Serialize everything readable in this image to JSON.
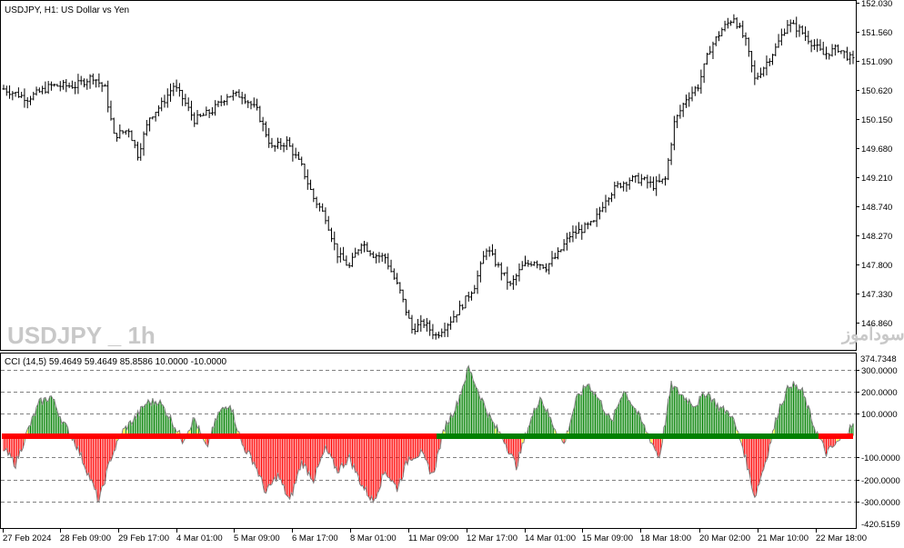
{
  "price_panel": {
    "title": "USDJPY, H1:  US Dollar vs Yen",
    "watermark_symbol": "USDJPY _ 1h",
    "watermark_site": "انتشار در سایت سودآموز",
    "y_labels": [
      "152.030",
      "151.560",
      "151.090",
      "150.620",
      "150.150",
      "149.680",
      "149.210",
      "148.740",
      "148.270",
      "147.800",
      "147.330",
      "146.860"
    ]
  },
  "indicator_panel": {
    "title": "CCI (14,5) 59.4649 59.4649 85.8586 10.0000 -10.0000",
    "y_labels": [
      "374.7348",
      "300.0000",
      "200.0000",
      "100.0000",
      "-100.0000",
      "-200.0000",
      "-300.0000",
      "-420.5159"
    ]
  },
  "x_labels": [
    "27 Feb 2024",
    "28 Feb 09:00",
    "29 Feb 17:00",
    "4 Mar 01:00",
    "5 Mar 09:00",
    "6 Mar 17:00",
    "8 Mar 01:00",
    "11 Mar 09:00",
    "12 Mar 17:00",
    "14 Mar 01:00",
    "15 Mar 09:00",
    "18 Mar 18:00",
    "20 Mar 02:00",
    "21 Mar 10:00",
    "22 Mar 18:00"
  ],
  "colors": {
    "bars": "#000000",
    "cci_up": "#008000",
    "cci_down": "#ff0000",
    "cci_neutral": "#808080",
    "cci_yellow": "#ffff00",
    "watermark": "#c8c8c8",
    "grid": "#808080"
  },
  "chart_data": [
    {
      "type": "line",
      "name": "USDJPY H1",
      "ylim": [
        146.5,
        152.03
      ],
      "anchors": [
        [
          0,
          150.65
        ],
        [
          8,
          150.5
        ],
        [
          16,
          150.7
        ],
        [
          24,
          150.7
        ],
        [
          30,
          150.85
        ],
        [
          34,
          150.65
        ],
        [
          37,
          149.9
        ],
        [
          42,
          150.0
        ],
        [
          45,
          149.6
        ],
        [
          49,
          150.2
        ],
        [
          53,
          150.4
        ],
        [
          57,
          150.7
        ],
        [
          60,
          150.5
        ],
        [
          64,
          150.15
        ],
        [
          70,
          150.3
        ],
        [
          75,
          150.55
        ],
        [
          80,
          150.55
        ],
        [
          85,
          150.3
        ],
        [
          90,
          149.7
        ],
        [
          95,
          149.8
        ],
        [
          100,
          149.4
        ],
        [
          104,
          148.9
        ],
        [
          108,
          148.6
        ],
        [
          112,
          148.0
        ],
        [
          116,
          147.8
        ],
        [
          120,
          148.2
        ],
        [
          124,
          148.0
        ],
        [
          128,
          147.95
        ],
        [
          133,
          147.4
        ],
        [
          137,
          146.8
        ],
        [
          141,
          146.9
        ],
        [
          145,
          146.7
        ],
        [
          150,
          146.95
        ],
        [
          154,
          147.2
        ],
        [
          158,
          147.5
        ],
        [
          162,
          148.1
        ],
        [
          166,
          147.8
        ],
        [
          170,
          147.5
        ],
        [
          174,
          147.8
        ],
        [
          178,
          147.9
        ],
        [
          182,
          147.8
        ],
        [
          186,
          148.0
        ],
        [
          190,
          148.3
        ],
        [
          194,
          148.4
        ],
        [
          198,
          148.5
        ],
        [
          202,
          148.9
        ],
        [
          206,
          149.1
        ],
        [
          210,
          149.2
        ],
        [
          214,
          149.2
        ],
        [
          218,
          149.1
        ],
        [
          222,
          149.2
        ],
        [
          225,
          150.1
        ],
        [
          229,
          150.5
        ],
        [
          233,
          150.7
        ],
        [
          237,
          151.3
        ],
        [
          241,
          151.6
        ],
        [
          245,
          151.8
        ],
        [
          249,
          151.4
        ],
        [
          252,
          150.8
        ],
        [
          255,
          151.0
        ],
        [
          259,
          151.3
        ],
        [
          263,
          151.7
        ],
        [
          267,
          151.6
        ],
        [
          271,
          151.4
        ],
        [
          275,
          151.2
        ],
        [
          280,
          151.3
        ],
        [
          285,
          151.1
        ]
      ]
    },
    {
      "type": "bar",
      "name": "CCI (14,5)",
      "ylim": [
        -420.5159,
        374.7348
      ],
      "anchors": [
        [
          0,
          -60
        ],
        [
          4,
          -130
        ],
        [
          8,
          20
        ],
        [
          12,
          150
        ],
        [
          16,
          180
        ],
        [
          20,
          60
        ],
        [
          24,
          -30
        ],
        [
          28,
          -160
        ],
        [
          32,
          -300
        ],
        [
          36,
          -100
        ],
        [
          40,
          20
        ],
        [
          44,
          80
        ],
        [
          48,
          150
        ],
        [
          52,
          160
        ],
        [
          56,
          80
        ],
        [
          60,
          -20
        ],
        [
          64,
          80
        ],
        [
          68,
          -60
        ],
        [
          72,
          100
        ],
        [
          76,
          150
        ],
        [
          80,
          -40
        ],
        [
          84,
          -120
        ],
        [
          88,
          -260
        ],
        [
          92,
          -180
        ],
        [
          96,
          -300
        ],
        [
          100,
          -120
        ],
        [
          104,
          -200
        ],
        [
          108,
          -60
        ],
        [
          112,
          -160
        ],
        [
          116,
          -100
        ],
        [
          120,
          -220
        ],
        [
          124,
          -300
        ],
        [
          128,
          -160
        ],
        [
          132,
          -240
        ],
        [
          136,
          -100
        ],
        [
          140,
          -80
        ],
        [
          144,
          -180
        ],
        [
          148,
          40
        ],
        [
          152,
          140
        ],
        [
          156,
          310
        ],
        [
          160,
          180
        ],
        [
          164,
          60
        ],
        [
          168,
          -20
        ],
        [
          172,
          -140
        ],
        [
          176,
          40
        ],
        [
          180,
          180
        ],
        [
          184,
          60
        ],
        [
          188,
          -40
        ],
        [
          192,
          160
        ],
        [
          196,
          240
        ],
        [
          200,
          160
        ],
        [
          204,
          60
        ],
        [
          208,
          210
        ],
        [
          212,
          120
        ],
        [
          216,
          10
        ],
        [
          220,
          -100
        ],
        [
          224,
          230
        ],
        [
          228,
          180
        ],
        [
          232,
          140
        ],
        [
          236,
          200
        ],
        [
          240,
          130
        ],
        [
          244,
          100
        ],
        [
          248,
          -50
        ],
        [
          252,
          -280
        ],
        [
          256,
          -100
        ],
        [
          260,
          120
        ],
        [
          264,
          240
        ],
        [
          268,
          200
        ],
        [
          272,
          40
        ],
        [
          276,
          -80
        ],
        [
          280,
          -30
        ],
        [
          285,
          50
        ]
      ]
    }
  ]
}
